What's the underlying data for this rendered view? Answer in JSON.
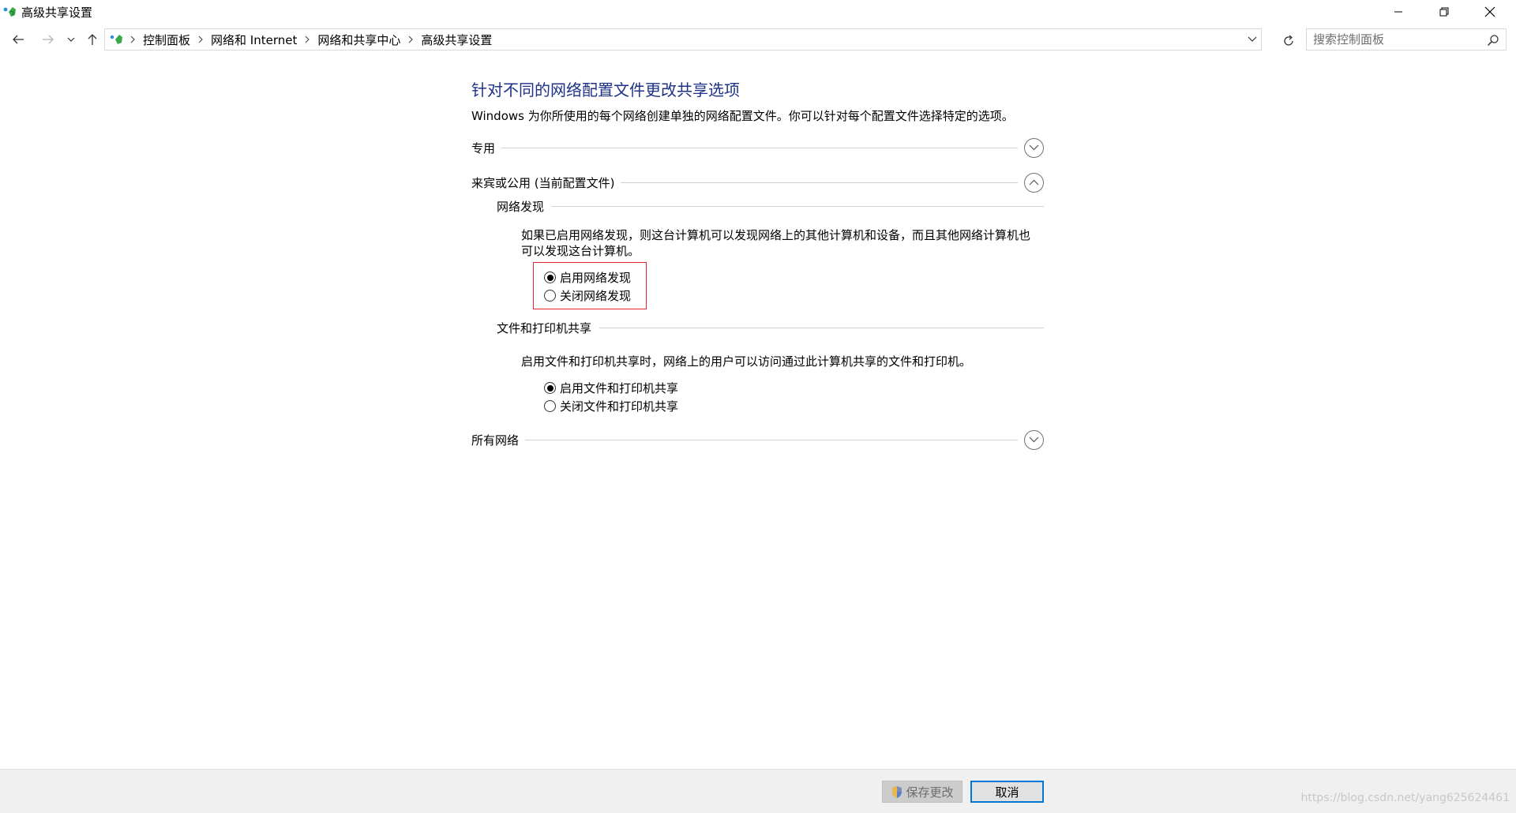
{
  "window": {
    "title": "高级共享设置"
  },
  "breadcrumb": {
    "items": [
      "控制面板",
      "网络和 Internet",
      "网络和共享中心",
      "高级共享设置"
    ]
  },
  "search": {
    "placeholder": "搜索控制面板"
  },
  "main": {
    "heading": "针对不同的网络配置文件更改共享选项",
    "description": "Windows 为你所使用的每个网络创建单独的网络配置文件。你可以针对每个配置文件选择特定的选项。",
    "profiles": {
      "private": {
        "label": "专用",
        "expanded": false
      },
      "guest_public": {
        "label": "来宾或公用 (当前配置文件)",
        "expanded": true,
        "network_discovery": {
          "title": "网络发现",
          "description_line1": "如果已启用网络发现，则这台计算机可以发现网络上的其他计算机和设备，而且其他网络计算机也",
          "description_line2": "可以发现这台计算机。",
          "options": [
            {
              "label": "启用网络发现",
              "checked": true
            },
            {
              "label": "关闭网络发现",
              "checked": false
            }
          ]
        },
        "file_printer_sharing": {
          "title": "文件和打印机共享",
          "description": "启用文件和打印机共享时，网络上的用户可以访问通过此计算机共享的文件和打印机。",
          "options": [
            {
              "label": "启用文件和打印机共享",
              "checked": true
            },
            {
              "label": "关闭文件和打印机共享",
              "checked": false
            }
          ]
        }
      },
      "all_networks": {
        "label": "所有网络",
        "expanded": false
      }
    }
  },
  "footer": {
    "save_label": "保存更改",
    "cancel_label": "取消",
    "watermark": "https://blog.csdn.net/yang625624461"
  },
  "colors": {
    "heading": "#1e3287",
    "highlight_border": "#e2262b",
    "focus_border": "#0078d7"
  }
}
